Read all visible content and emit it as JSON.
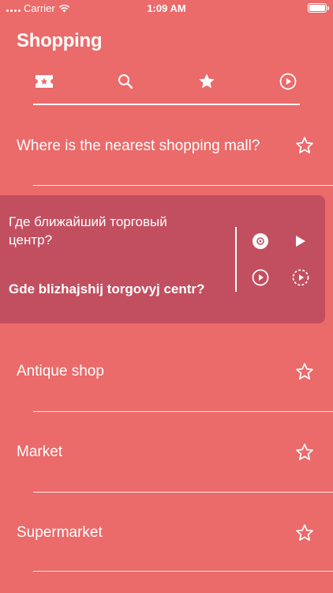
{
  "status": {
    "carrier": "Carrier",
    "time": "1:09 AM"
  },
  "header": {
    "title": "Shopping"
  },
  "tabs": [
    {
      "icon": "ticket-icon"
    },
    {
      "icon": "search-icon"
    },
    {
      "icon": "star-icon"
    },
    {
      "icon": "play-circle-icon"
    }
  ],
  "phrases": [
    {
      "text": "Where is the nearest shopping mall?",
      "expanded": true
    },
    {
      "text": "Antique shop"
    },
    {
      "text": "Market"
    },
    {
      "text": "Supermarket"
    }
  ],
  "card": {
    "native": "Где ближайший торговый центр?",
    "translit": "Gde blizhajshij torgovyj centr?"
  },
  "colors": {
    "background": "#EB6A6A",
    "card": "#C24F60",
    "foreground": "#FFFFFF"
  }
}
